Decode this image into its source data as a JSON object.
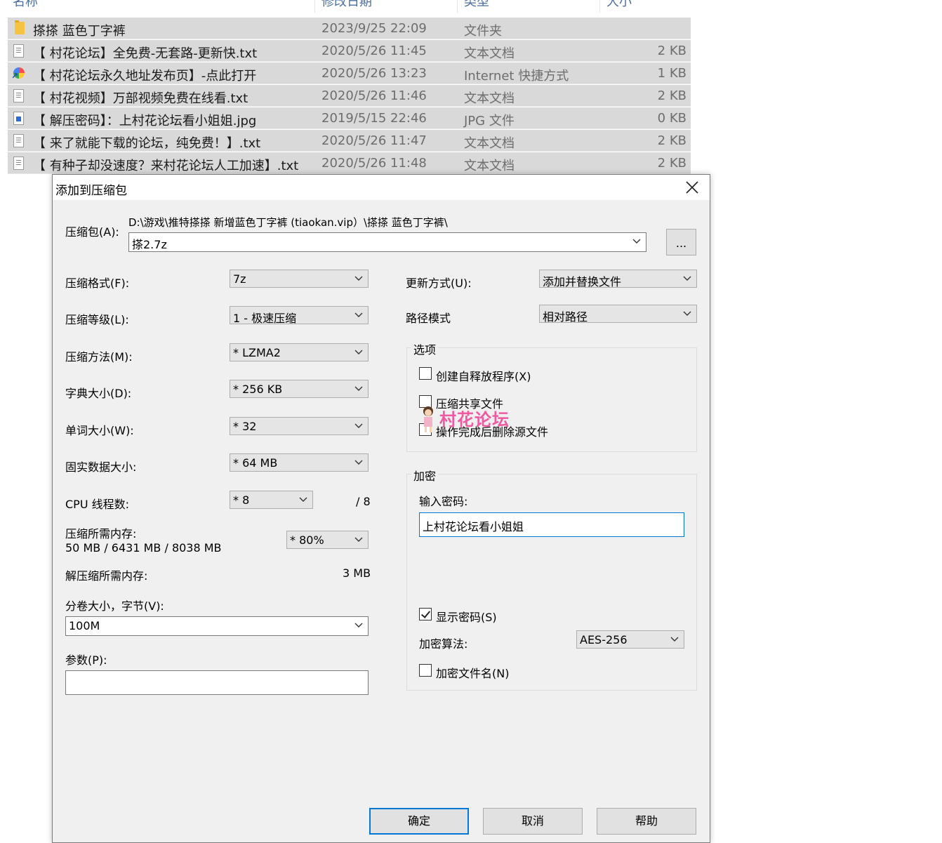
{
  "explorer": {
    "columns": [
      "名称",
      "修改日期",
      "类型",
      "大小"
    ],
    "files": [
      {
        "icon": "folder-icon",
        "name": "搽搽 蓝色丁字裤",
        "date": "2023/9/25 22:09",
        "type": "文件夹",
        "size": ""
      },
      {
        "icon": "text-file-icon",
        "name": "【 村花论坛】全免费-无套路-更新快.txt",
        "date": "2020/5/26 11:45",
        "type": "文本文档",
        "size": "2 KB"
      },
      {
        "icon": "internet-shortcut-icon",
        "name": "【 村花论坛永久地址发布页】-点此打开",
        "date": "2020/5/26 13:23",
        "type": "Internet 快捷方式",
        "size": "1 KB"
      },
      {
        "icon": "text-file-icon",
        "name": "【 村花视频】万部视频免费在线看.txt",
        "date": "2020/5/26 11:46",
        "type": "文本文档",
        "size": "2 KB"
      },
      {
        "icon": "image-file-icon",
        "name": "【 解压密码】：上村花论坛看小姐姐.jpg",
        "date": "2019/5/15 22:46",
        "type": "JPG 文件",
        "size": "0 KB"
      },
      {
        "icon": "text-file-icon",
        "name": "【 来了就能下载的论坛，纯免费！】.txt",
        "date": "2020/5/26 11:47",
        "type": "文本文档",
        "size": "2 KB"
      },
      {
        "icon": "text-file-icon",
        "name": "【 有种子却没速度？来村花论坛人工加速】.txt",
        "date": "2020/5/26 11:48",
        "type": "文本文档",
        "size": "2 KB"
      }
    ]
  },
  "dialog": {
    "title": "添加到压缩包",
    "archive_label": "压缩包(A):",
    "archive_path": "D:\\游戏\\推特搽搽 新增蓝色丁字裤 (tiaokan.vip）\\搽搽 蓝色丁字裤\\",
    "archive_name": "搽2.7z",
    "browse_label": "...",
    "format_label": "压缩格式(F):",
    "format_value": "7z",
    "level_label": "压缩等级(L):",
    "level_value": "1 - 极速压缩",
    "method_label": "压缩方法(M):",
    "method_value": "* LZMA2",
    "dict_label": "字典大小(D):",
    "dict_value": "* 256 KB",
    "word_label": "单词大小(W):",
    "word_value": "* 32",
    "solid_label": "固实数据大小:",
    "solid_value": "* 64 MB",
    "cpu_label": "CPU 线程数:",
    "cpu_value": "* 8",
    "cpu_max": "/ 8",
    "mem_label": "压缩所需内存:",
    "mem_value": "50 MB / 6431 MB / 8038 MB",
    "mem_percent": "* 80%",
    "decomp_label": "解压缩所需内存:",
    "decomp_value": "3 MB",
    "volume_label": "分卷大小，字节(V):",
    "volume_value": "100M",
    "params_label": "参数(P):",
    "params_value": "",
    "update_label": "更新方式(U):",
    "update_value": "添加并替换文件",
    "path_label": "路径模式",
    "path_value": "相对路径",
    "options_title": "选项",
    "opt_sfx": "创建自释放程序(X)",
    "opt_shared": "压缩共享文件",
    "opt_delete": "操作完成后删除源文件",
    "encrypt_title": "加密",
    "password_label": "输入密码:",
    "password_value": "上村花论坛看小姐姐",
    "show_password": "显示密码(S)",
    "algo_label": "加密算法:",
    "algo_value": "AES-256",
    "encrypt_names": "加密文件名(N)",
    "ok": "确定",
    "cancel": "取消",
    "help": "帮助"
  },
  "watermark": "村花论坛",
  "colors": {
    "accent": "#0078d7",
    "watermark": "#ef5aa0",
    "row_bg": "#d9d9d9",
    "dialog_bg": "#f0f0f0"
  }
}
